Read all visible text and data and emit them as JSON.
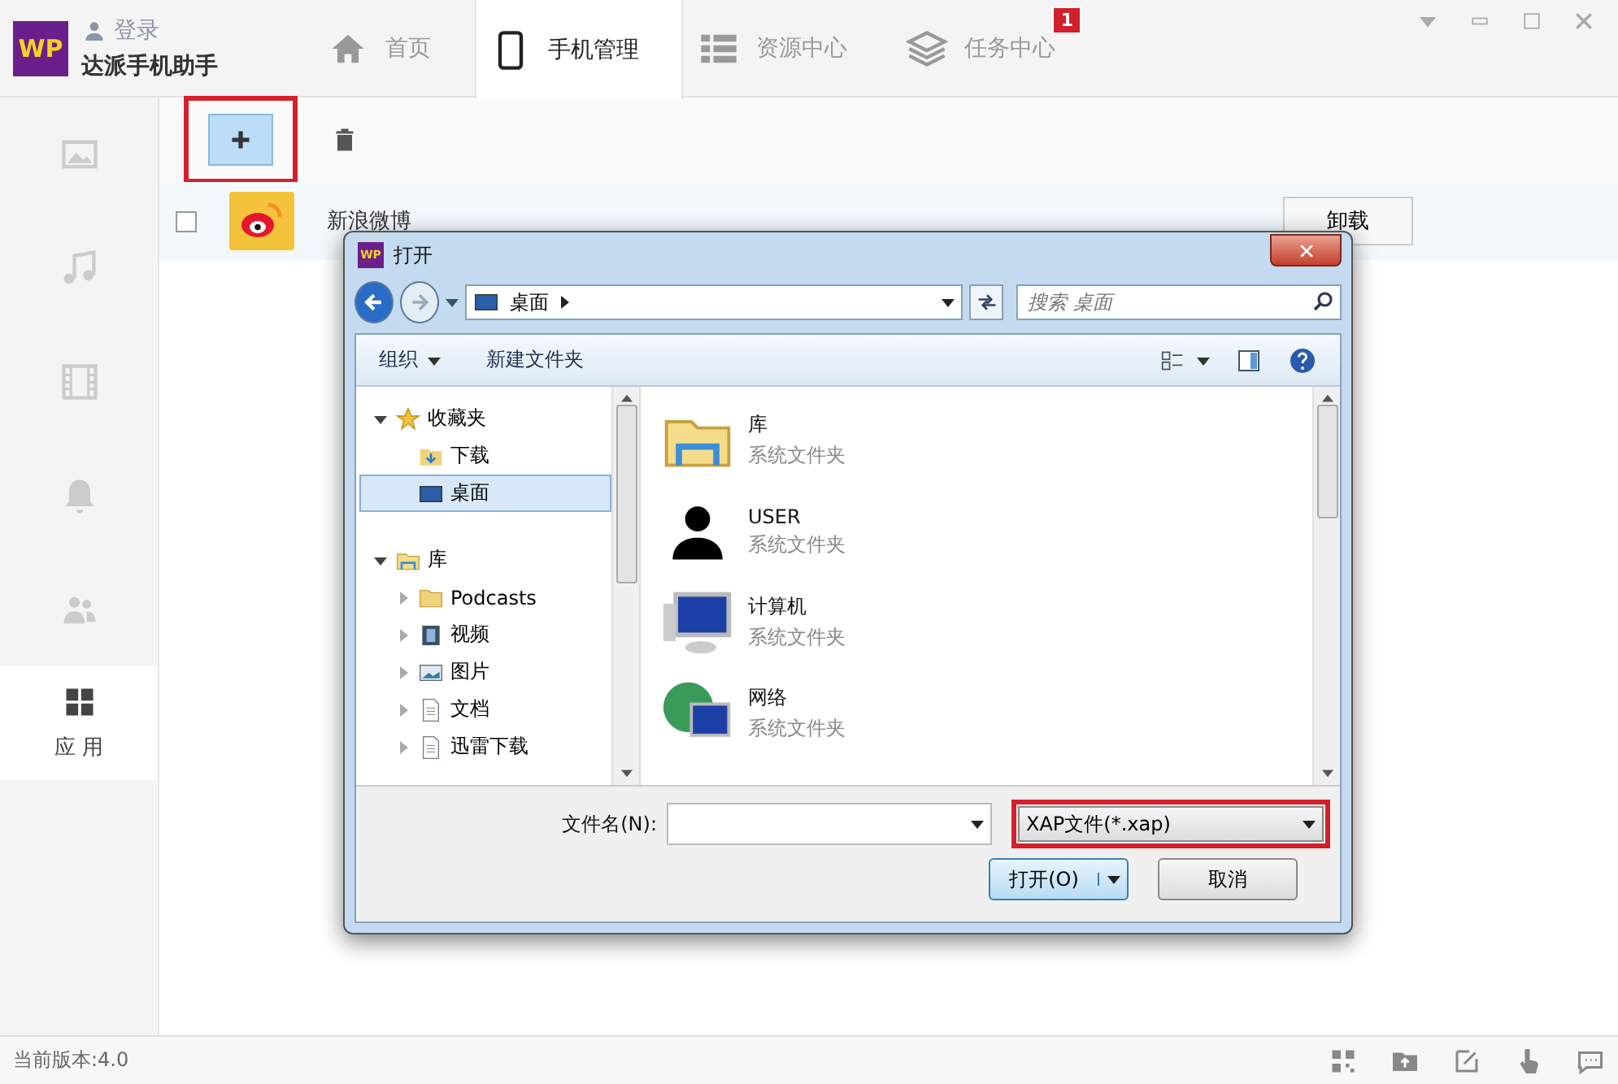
{
  "app": {
    "logo": "WP",
    "login": "登录",
    "name": "达派手机助手"
  },
  "tabs": [
    {
      "label": "首页",
      "selected": false
    },
    {
      "label": "手机管理",
      "selected": true
    },
    {
      "label": "资源中心",
      "selected": false
    },
    {
      "label": "任务中心",
      "selected": false,
      "badge": "1"
    }
  ],
  "sidebar": [
    {
      "selected": false
    },
    {
      "selected": false
    },
    {
      "selected": false
    },
    {
      "selected": false
    },
    {
      "selected": false
    },
    {
      "label": "应 用",
      "selected": true
    }
  ],
  "app_list": [
    {
      "name": "新浪微博",
      "checked": false,
      "action": "卸载"
    }
  ],
  "dialog": {
    "logo": "WP",
    "title": "打开",
    "path": "桌面",
    "search_placeholder": "搜索 桌面",
    "organize": "组织",
    "new_folder": "新建文件夹",
    "tree": [
      {
        "label": "收藏夹",
        "expanded": true,
        "children": [
          {
            "label": "下载",
            "selected": false
          },
          {
            "label": "桌面",
            "selected": true
          }
        ]
      },
      {
        "label": "库",
        "expanded": true,
        "children": [
          {
            "label": "Podcasts",
            "expanded": false,
            "selected": false
          },
          {
            "label": "视频",
            "expanded": false,
            "selected": false
          },
          {
            "label": "图片",
            "expanded": false,
            "selected": false
          },
          {
            "label": "文档",
            "expanded": false,
            "selected": false
          },
          {
            "label": "迅雷下载",
            "expanded": false,
            "selected": false
          }
        ]
      }
    ],
    "files": [
      {
        "name": "库",
        "type": "系统文件夹"
      },
      {
        "name": "USER",
        "type": "系统文件夹"
      },
      {
        "name": "计算机",
        "type": "系统文件夹"
      },
      {
        "name": "网络",
        "type": "系统文件夹"
      }
    ],
    "filename_label": "文件名(N):",
    "filetype": "XAP文件(*.xap)",
    "open": "打开(O)",
    "cancel": "取消"
  },
  "status": {
    "version": "当前版本:4.0"
  }
}
